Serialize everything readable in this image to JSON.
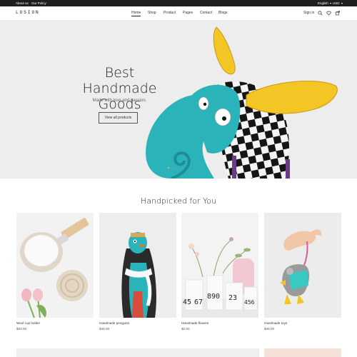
{
  "topbar": {
    "links": [
      "About us",
      "Our Policy"
    ],
    "language": "English",
    "currency": "USD"
  },
  "header": {
    "logo": "LUSION",
    "nav": [
      "Home",
      "Shop",
      "Product",
      "Pages",
      "Contact",
      "Blogs"
    ],
    "active_nav": "Home",
    "sign_in": "Sign in",
    "cart_count": "0",
    "icons": [
      "search-icon",
      "heart-icon",
      "cart-icon"
    ]
  },
  "hero": {
    "title_line1": "Best Handmade",
    "title_line2": "Goods",
    "subtitle": "Made with love and passion.",
    "button": "View all products"
  },
  "section": {
    "title": "Handpicked for You"
  },
  "products": [
    {
      "name": "Wool cup holder",
      "price": "$20.00"
    },
    {
      "name": "Handmade penguins",
      "price": "$46.00"
    },
    {
      "name": "Handmade flowers",
      "price": "$2.00"
    },
    {
      "name": "Handmade toys",
      "price": "$46.00"
    }
  ],
  "vase_numbers": [
    "45",
    "67",
    "890",
    "23",
    "456"
  ],
  "colors": {
    "topbar": "#1e1e1e",
    "hero_bg": "#ededed",
    "toy_teal": "#2ab3b8",
    "toy_yellow": "#f3c625"
  }
}
